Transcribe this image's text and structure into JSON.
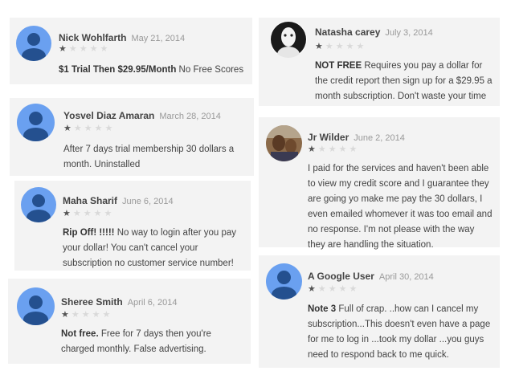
{
  "reviews": [
    {
      "author": "Nick Wohlfarth",
      "date": "May 21, 2014",
      "rating": 1,
      "max_rating": 5,
      "title": "$1 Trial Then $29.95/Month",
      "body": " No Free Scores",
      "avatar": "default-avatar-icon"
    },
    {
      "author": "Yosvel Diaz Amaran",
      "date": "March 28, 2014",
      "rating": 1,
      "max_rating": 5,
      "title": "",
      "body": "After 7 days trial membership 30 dollars a month. Uninstalled",
      "avatar": "default-avatar-icon"
    },
    {
      "author": "Maha Sharif",
      "date": "June 6, 2014",
      "rating": 1,
      "max_rating": 5,
      "title": "Rip Off! !!!!!",
      "body": " No way to login after you pay your dollar! You can't cancel your subscription no customer service number!",
      "avatar": "default-avatar-icon"
    },
    {
      "author": "Sheree Smith",
      "date": "April 6, 2014",
      "rating": 1,
      "max_rating": 5,
      "title": "Not free.",
      "body": " Free for 7 days then you're charged monthly. False advertising.",
      "avatar": "default-avatar-icon"
    },
    {
      "author": "Natasha carey",
      "date": "July 3, 2014",
      "rating": 1,
      "max_rating": 5,
      "title": "NOT FREE",
      "body": " Requires you pay a dollar for the credit report then sign up for a $29.95 a month subscription. Don't waste your time",
      "avatar": "user-photo-avatar"
    },
    {
      "author": "Jr Wilder",
      "date": "June 2, 2014",
      "rating": 1,
      "max_rating": 5,
      "title": "",
      "body": "I paid for the services and haven't been able to view my credit score and I guarantee they are going yo make me pay the 30 dollars, I even emailed whomever it was too email and no response. I'm not please with the way they are handling the situation.",
      "avatar": "user-photo-avatar"
    },
    {
      "author": "A Google User",
      "date": "April 30, 2014",
      "rating": 1,
      "max_rating": 5,
      "title": "Note 3",
      "body": " Full of crap. ..how can I cancel my subscription...This doesn't even have a page for me to log in ...took my dollar ...you guys need to respond back to me quick.",
      "avatar": "default-avatar-icon"
    }
  ],
  "colors": {
    "card_bg": "#f3f3f3",
    "avatar_bg": "#6aa0f0",
    "avatar_fg": "#24508f",
    "star_on": "#555555",
    "star_off": "#d9d9d9"
  }
}
